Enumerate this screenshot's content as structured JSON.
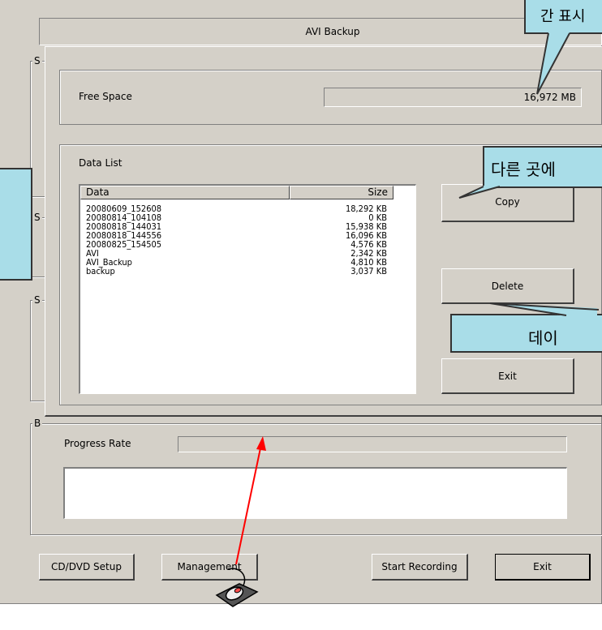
{
  "back_window": {
    "title": "AVI Backup",
    "side_group_letters": [
      "S",
      "S",
      "S",
      "B"
    ],
    "progress_label": "Progress Rate",
    "buttons": {
      "cd_dvd_setup": "CD/DVD Setup",
      "management": "Management",
      "start_recording": "Start Recording",
      "exit": "Exit"
    }
  },
  "dialog": {
    "free_space_label": "Free Space",
    "free_space_value": "16,972 MB",
    "data_list_label": "Data List",
    "columns": {
      "data": "Data",
      "size": "Size"
    },
    "rows": [
      {
        "name": "20080609_152608",
        "size": "18,292 KB"
      },
      {
        "name": "20080814_104108",
        "size": "0 KB"
      },
      {
        "name": "20080818_144031",
        "size": "15,938 KB"
      },
      {
        "name": "20080818_144556",
        "size": "16,096 KB"
      },
      {
        "name": "20080825_154505",
        "size": "4,576 KB"
      },
      {
        "name": "AVI",
        "size": "2,342 KB"
      },
      {
        "name": "AVI_Backup",
        "size": "4,810 KB"
      },
      {
        "name": "backup",
        "size": "3,037 KB"
      }
    ],
    "buttons": {
      "copy": "Copy",
      "delete": "Delete",
      "exit": "Exit"
    }
  },
  "callouts": {
    "top": "간 표시",
    "copy": "다른 곳에",
    "delete": "데이"
  },
  "colors": {
    "callout": "#a9dde8",
    "arrow": "#ff0000",
    "window": "#d4d0c8"
  },
  "icons": {
    "mouse": "mouse-pad-icon"
  }
}
